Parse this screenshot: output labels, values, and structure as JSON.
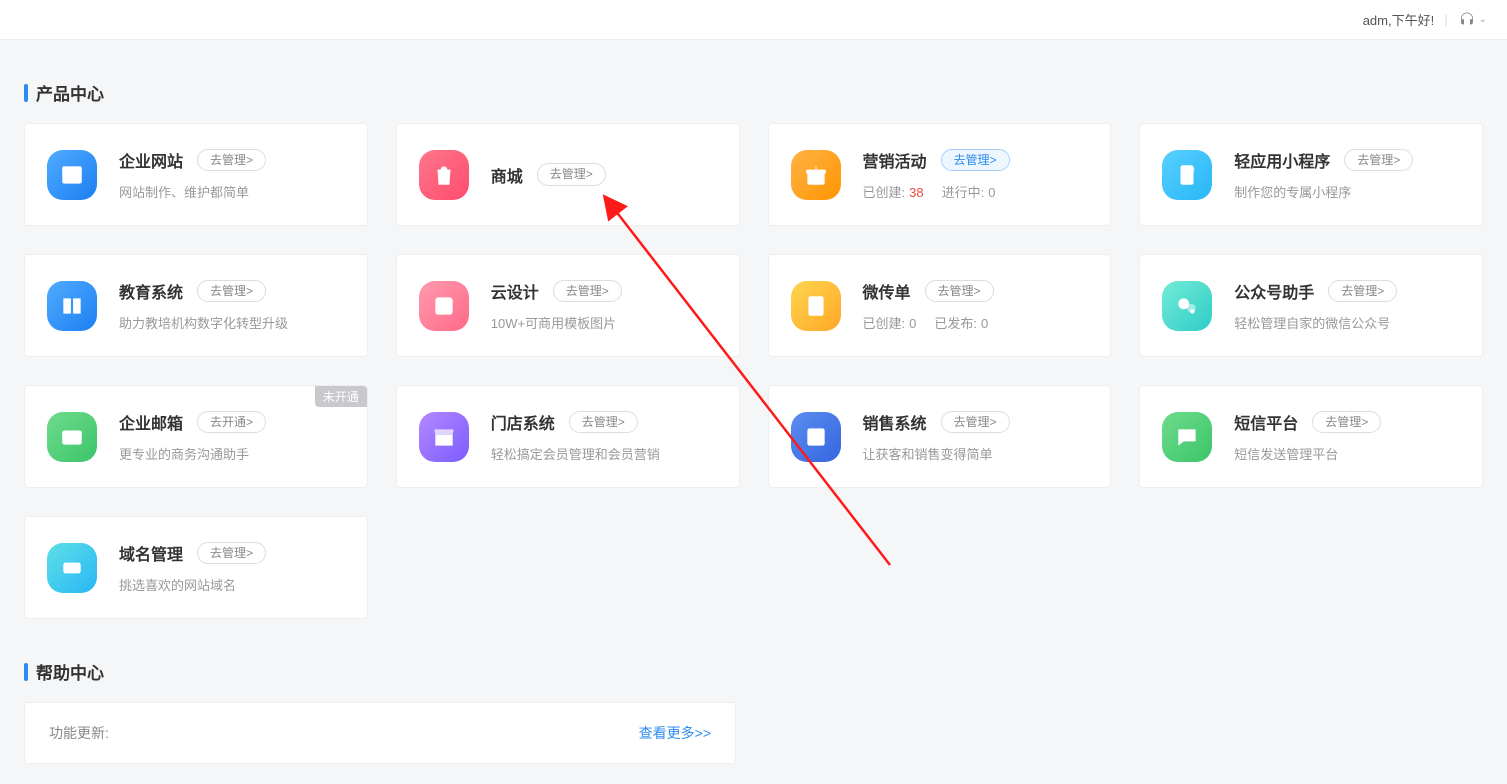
{
  "header": {
    "greeting": "adm,下午好!"
  },
  "sections": {
    "products_title": "产品中心",
    "help_title": "帮助中心"
  },
  "common": {
    "manage_btn": "去管理>",
    "open_btn": "去开通>",
    "not_opened_tag": "未开通"
  },
  "cards": {
    "website": {
      "title": "企业网站",
      "desc": "网站制作、维护都简单"
    },
    "mall": {
      "title": "商城"
    },
    "marketing": {
      "title": "营销活动",
      "stats": {
        "created_label": "已创建:",
        "created_value": "38",
        "progress_label": "进行中:",
        "progress_value": "0"
      }
    },
    "miniapp": {
      "title": "轻应用小程序",
      "desc": "制作您的专属小程序"
    },
    "edu": {
      "title": "教育系统",
      "desc": "助力教培机构数字化转型升级"
    },
    "design": {
      "title": "云设计",
      "desc": "10W+可商用模板图片"
    },
    "flyer": {
      "title": "微传单",
      "stats": {
        "created_label": "已创建:",
        "created_value": "0",
        "pub_label": "已发布:",
        "pub_value": "0"
      }
    },
    "mp": {
      "title": "公众号助手",
      "desc": "轻松管理自家的微信公众号"
    },
    "mail": {
      "title": "企业邮箱",
      "desc": "更专业的商务沟通助手"
    },
    "store": {
      "title": "门店系统",
      "desc": "轻松搞定会员管理和会员营销"
    },
    "sales": {
      "title": "销售系统",
      "desc": "让获客和销售变得简单"
    },
    "sms": {
      "title": "短信平台",
      "desc": "短信发送管理平台"
    },
    "domain": {
      "title": "域名管理",
      "desc": "挑选喜欢的网站域名"
    }
  },
  "help": {
    "updates_label": "功能更新:",
    "more": "查看更多>>"
  }
}
